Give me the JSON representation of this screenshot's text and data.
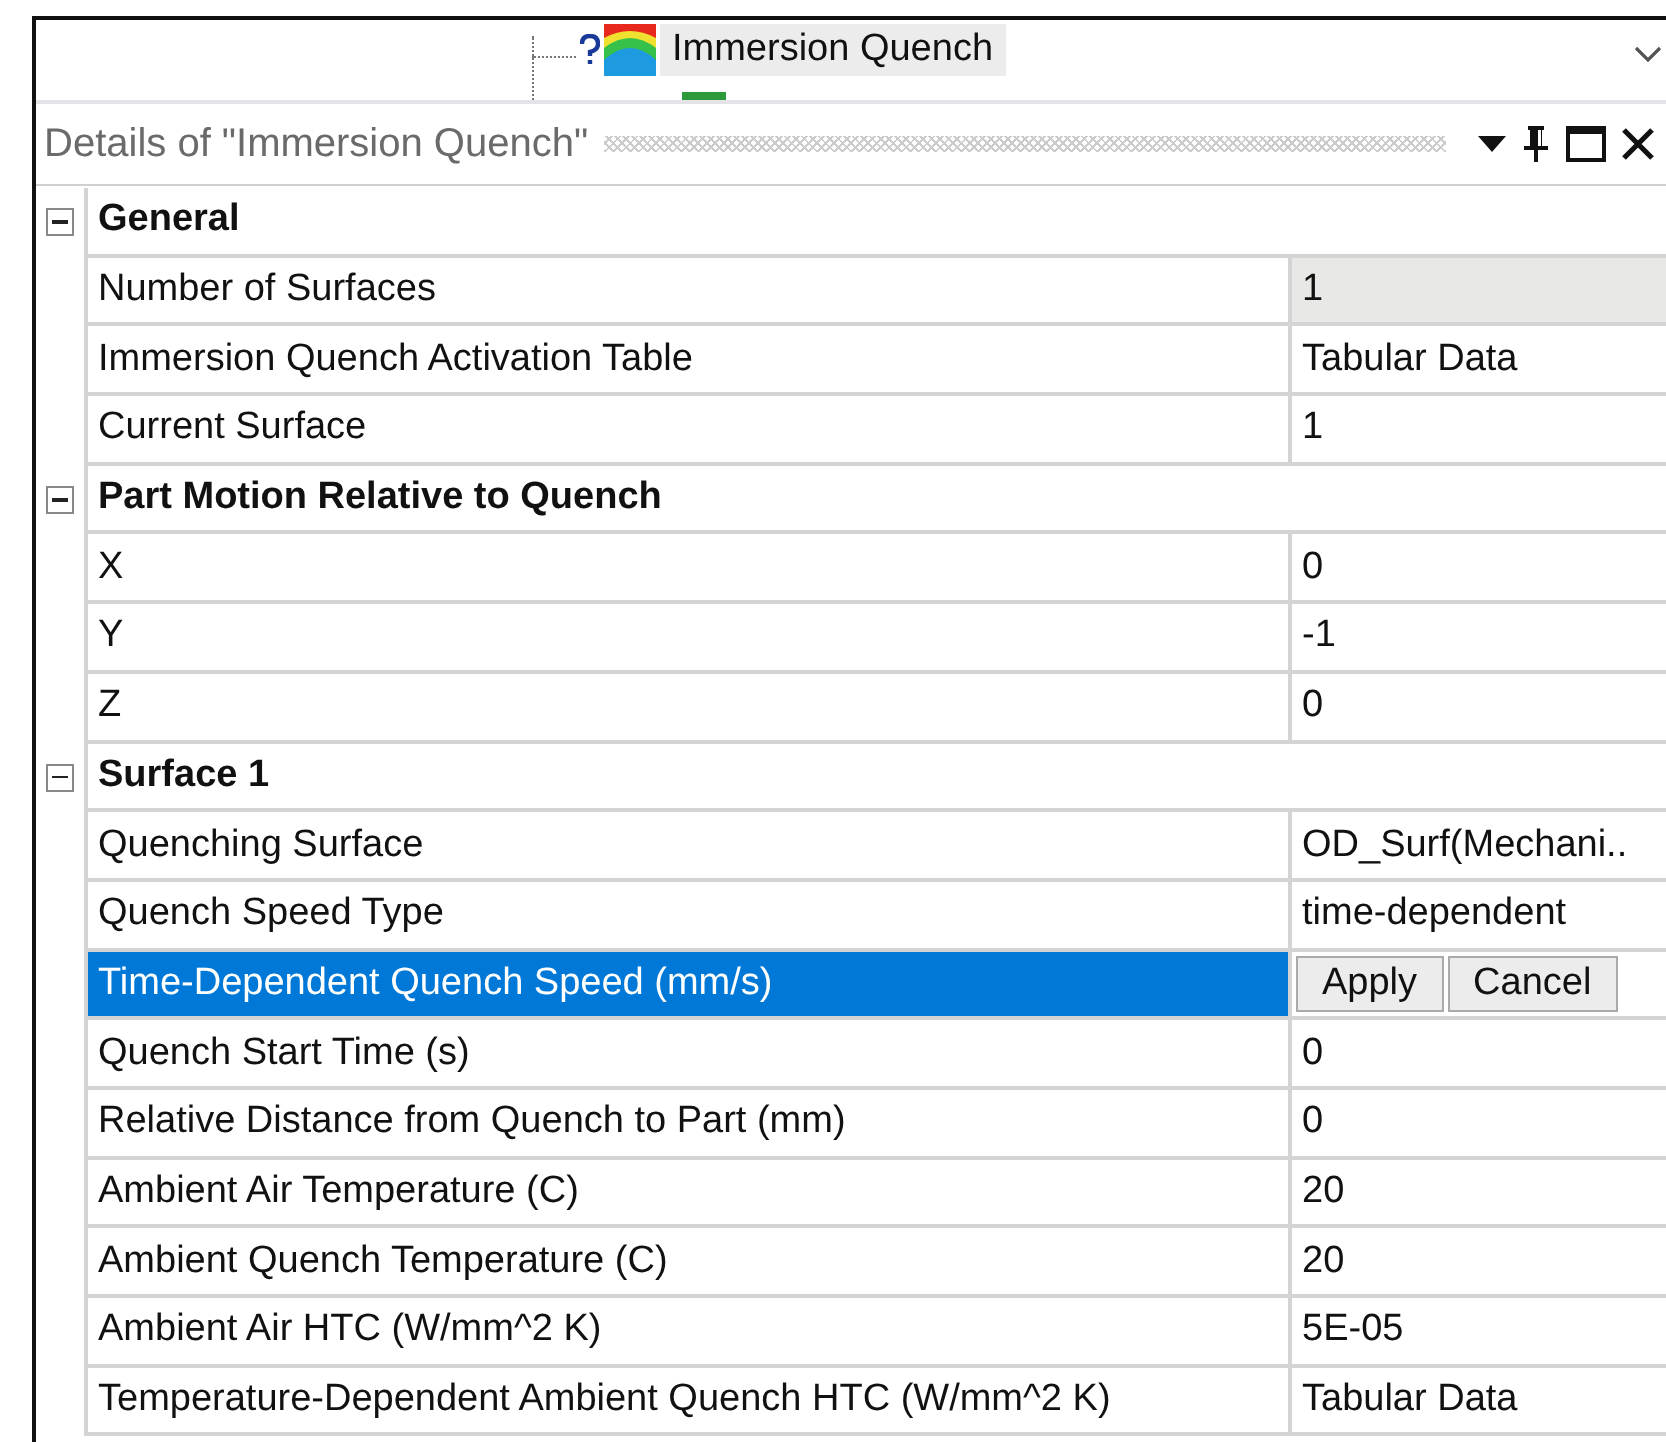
{
  "tree": {
    "item": {
      "label": "Immersion Quench",
      "selected": true
    }
  },
  "details": {
    "title": "Details of \"Immersion Quench\""
  },
  "groups": [
    {
      "name": "General",
      "expanded": true,
      "properties": [
        {
          "name": "Number of Surfaces",
          "kind": "text",
          "value": "1",
          "read_only": true,
          "selected": false
        },
        {
          "name": "Immersion Quench Activation Table",
          "kind": "text",
          "value": "Tabular Data",
          "read_only": false,
          "selected": false
        },
        {
          "name": "Current Surface",
          "kind": "text",
          "value": "1",
          "read_only": false,
          "selected": false
        }
      ]
    },
    {
      "name": "Part Motion Relative to Quench",
      "expanded": true,
      "properties": [
        {
          "name": "X",
          "kind": "text",
          "value": "0",
          "read_only": false,
          "selected": false
        },
        {
          "name": "Y",
          "kind": "text",
          "value": "-1",
          "read_only": false,
          "selected": false
        },
        {
          "name": "Z",
          "kind": "text",
          "value": "0",
          "read_only": false,
          "selected": false
        }
      ]
    },
    {
      "name": "Surface 1",
      "expanded": true,
      "properties": [
        {
          "name": "Quenching Surface",
          "kind": "text",
          "value": "OD_Surf(Mechani..",
          "read_only": false,
          "selected": false
        },
        {
          "name": "Quench Speed Type",
          "kind": "text",
          "value": "time-dependent",
          "read_only": false,
          "selected": false
        },
        {
          "name": "Time-Dependent Quench Speed (mm/s)",
          "kind": "buttons",
          "buttons": [
            "Apply",
            "Cancel"
          ],
          "read_only": false,
          "selected": true
        },
        {
          "name": "Quench Start Time (s)",
          "kind": "text",
          "value": "0",
          "read_only": false,
          "selected": false
        },
        {
          "name": "Relative Distance from Quench to Part (mm)",
          "kind": "text",
          "value": "0",
          "read_only": false,
          "selected": false
        },
        {
          "name": "Ambient Air Temperature (C)",
          "kind": "text",
          "value": "20",
          "read_only": false,
          "selected": false
        },
        {
          "name": "Ambient Quench Temperature (C)",
          "kind": "text",
          "value": "20",
          "read_only": false,
          "selected": false
        },
        {
          "name": "Ambient Air HTC (W/mm^2 K)",
          "kind": "text",
          "value": "5E-05",
          "read_only": false,
          "selected": false
        },
        {
          "name": "Temperature-Dependent Ambient Quench HTC (W/mm^2 K)",
          "kind": "text",
          "value": "Tabular Data",
          "read_only": false,
          "selected": false
        }
      ]
    }
  ]
}
